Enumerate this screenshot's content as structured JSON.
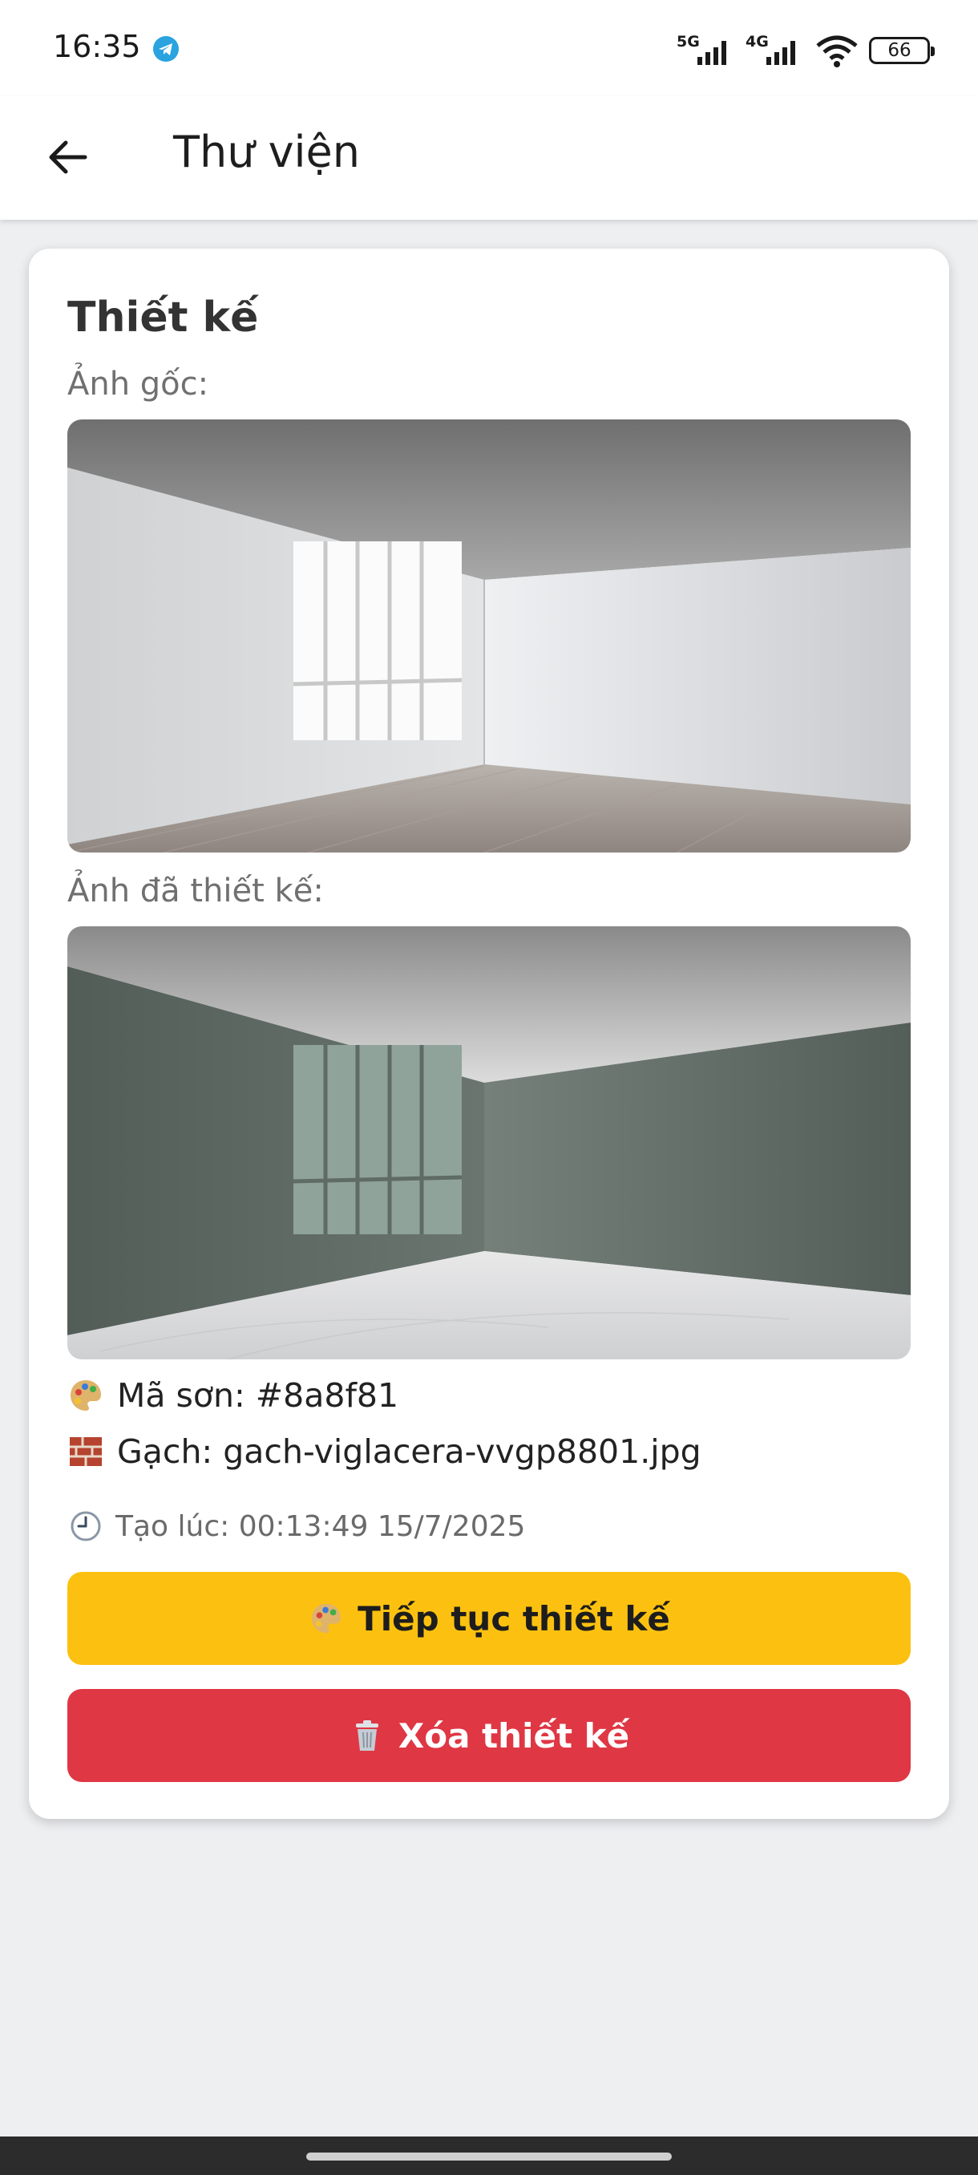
{
  "status_bar": {
    "time": "16:35",
    "network_1": "5G",
    "network_2": "4G",
    "battery": "66"
  },
  "app_bar": {
    "title": "Thư viện",
    "back_icon": "arrow-left-icon"
  },
  "card": {
    "title": "Thiết kế",
    "original_label": "Ảnh gốc:",
    "designed_label": "Ảnh đã thiết kế:",
    "paint_label": "Mã sơn: #8a8f81",
    "tile_label": "Gạch: gach-viglacera-vvgp8801.jpg",
    "created_label": "Tạo lúc: 00:13:49 15/7/2025",
    "continue_button": "Tiếp tục thiết kế",
    "delete_button": "Xóa thiết kế"
  },
  "colors": {
    "paint_color": "#8a8f81",
    "continue_bg": "#fcc110",
    "delete_bg": "#df3744"
  },
  "icons": {
    "palette": "palette-icon",
    "brick": "brick-icon",
    "clock": "clock-icon",
    "trash": "trash-icon",
    "telegram": "telegram-icon",
    "wifi": "wifi-icon"
  }
}
